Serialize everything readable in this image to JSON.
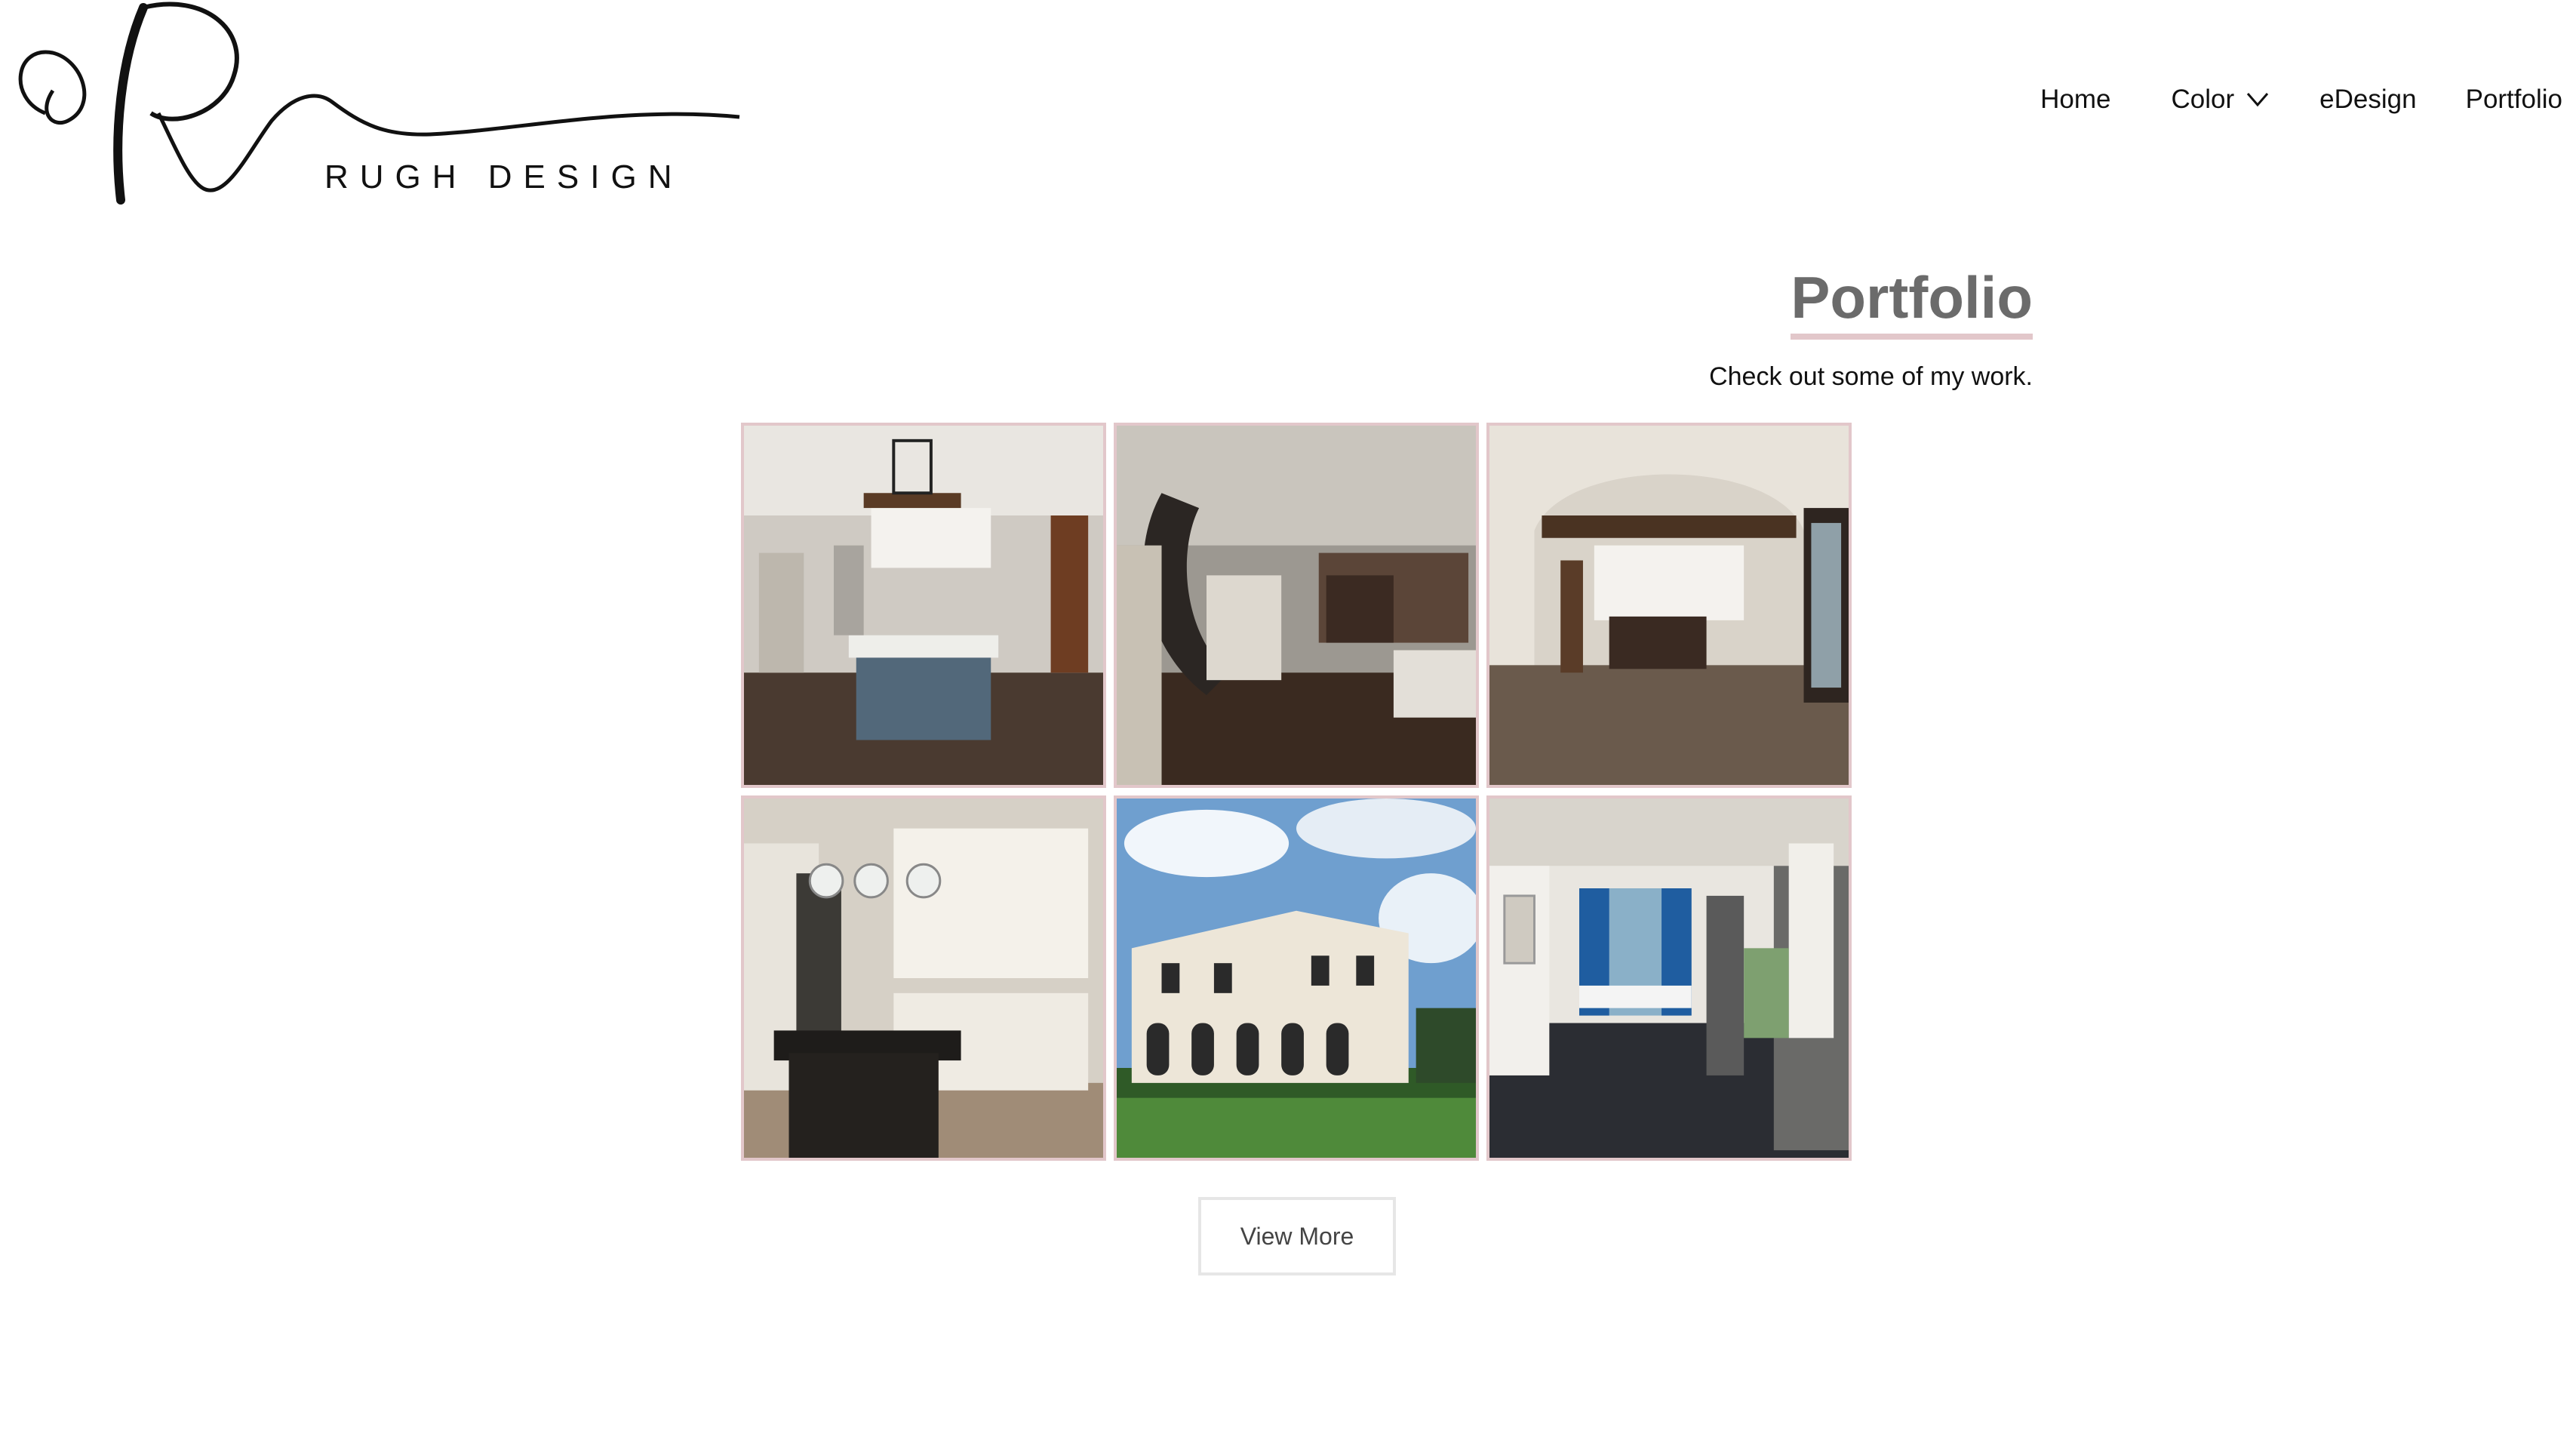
{
  "brand": {
    "monogram": "R",
    "name": "RUGH DESIGN"
  },
  "nav": {
    "items": [
      {
        "label": "Home"
      },
      {
        "label": "Color",
        "has_dropdown": true
      },
      {
        "label": "eDesign"
      },
      {
        "label": "Portfolio"
      }
    ]
  },
  "portfolio": {
    "title": "Portfolio",
    "subtitle": "Check out some of my work.",
    "tiles": [
      {
        "subject": "kitchen-with-blue-island"
      },
      {
        "subject": "curved-staircase-living-room"
      },
      {
        "subject": "open-kitchen-arched-entry"
      },
      {
        "subject": "white-kitchen-dark-island"
      },
      {
        "subject": "white-stone-mansion-exterior"
      },
      {
        "subject": "covered-porch-blue-curtains"
      }
    ],
    "view_more_label": "View More"
  },
  "colors": {
    "accent": "#e2c7ca",
    "title": "#6b6b6b",
    "text": "#111111",
    "button_border": "#e6e6e6"
  }
}
